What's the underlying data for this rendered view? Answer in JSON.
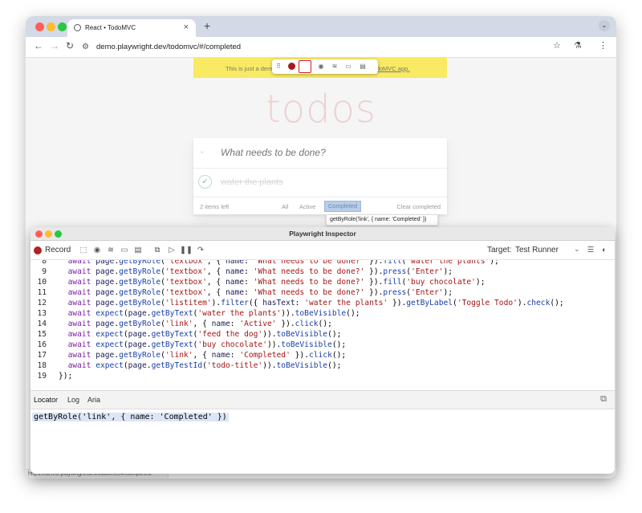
{
  "browser": {
    "tab_title": "React • TodoMVC",
    "new_tab_glyph": "+",
    "url": "demo.playwright.dev/todomvc/#/completed"
  },
  "page": {
    "banner_left": "This is just a dem",
    "banner_right": "al TodoMVC app.",
    "title": "todos",
    "new_todo_placeholder": "What needs to be done?",
    "todo_item": "water the plants",
    "items_left": "2 items left",
    "filters": [
      "All",
      "Active",
      "Completed"
    ],
    "clear_completed": "Clear completed",
    "tooltip": "getByRole('link', { name: 'Completed' })",
    "status_url": "https://demo.playwright.dev/todomvc/#/completed"
  },
  "inspector": {
    "title": "Playwright Inspector",
    "record_label": "Record",
    "target_label": "Target:",
    "target_value": "Test Runner",
    "tabs": [
      "Locator",
      "Log",
      "Aria"
    ],
    "locator": "getByRole('link', { name: 'Completed' })",
    "code_lines": [
      [
        {
          "t": "  "
        },
        {
          "c": "kw",
          "t": "await"
        },
        {
          "t": " "
        },
        {
          "c": "pr",
          "t": "page"
        },
        {
          "t": "."
        },
        {
          "c": "fn",
          "t": "getByRole"
        },
        {
          "t": "("
        },
        {
          "c": "st",
          "t": "'textbox'"
        },
        {
          "t": ", { "
        },
        {
          "c": "pr",
          "t": "name"
        },
        {
          "t": ": "
        },
        {
          "c": "st",
          "t": "'What needs to be done?'"
        },
        {
          "t": " })."
        },
        {
          "c": "fn",
          "t": "fill"
        },
        {
          "t": "("
        },
        {
          "c": "st",
          "t": "'water the plants'"
        },
        {
          "t": ");"
        }
      ],
      [
        {
          "t": "  "
        },
        {
          "c": "kw",
          "t": "await"
        },
        {
          "t": " "
        },
        {
          "c": "pr",
          "t": "page"
        },
        {
          "t": "."
        },
        {
          "c": "fn",
          "t": "getByRole"
        },
        {
          "t": "("
        },
        {
          "c": "st",
          "t": "'textbox'"
        },
        {
          "t": ", { "
        },
        {
          "c": "pr",
          "t": "name"
        },
        {
          "t": ": "
        },
        {
          "c": "st",
          "t": "'What needs to be done?'"
        },
        {
          "t": " })."
        },
        {
          "c": "fn",
          "t": "press"
        },
        {
          "t": "("
        },
        {
          "c": "st",
          "t": "'Enter'"
        },
        {
          "t": ");"
        }
      ],
      [
        {
          "t": "  "
        },
        {
          "c": "kw",
          "t": "await"
        },
        {
          "t": " "
        },
        {
          "c": "pr",
          "t": "page"
        },
        {
          "t": "."
        },
        {
          "c": "fn",
          "t": "getByRole"
        },
        {
          "t": "("
        },
        {
          "c": "st",
          "t": "'textbox'"
        },
        {
          "t": ", { "
        },
        {
          "c": "pr",
          "t": "name"
        },
        {
          "t": ": "
        },
        {
          "c": "st",
          "t": "'What needs to be done?'"
        },
        {
          "t": " })."
        },
        {
          "c": "fn",
          "t": "fill"
        },
        {
          "t": "("
        },
        {
          "c": "st",
          "t": "'buy chocolate'"
        },
        {
          "t": ");"
        }
      ],
      [
        {
          "t": "  "
        },
        {
          "c": "kw",
          "t": "await"
        },
        {
          "t": " "
        },
        {
          "c": "pr",
          "t": "page"
        },
        {
          "t": "."
        },
        {
          "c": "fn",
          "t": "getByRole"
        },
        {
          "t": "("
        },
        {
          "c": "st",
          "t": "'textbox'"
        },
        {
          "t": ", { "
        },
        {
          "c": "pr",
          "t": "name"
        },
        {
          "t": ": "
        },
        {
          "c": "st",
          "t": "'What needs to be done?'"
        },
        {
          "t": " })."
        },
        {
          "c": "fn",
          "t": "press"
        },
        {
          "t": "("
        },
        {
          "c": "st",
          "t": "'Enter'"
        },
        {
          "t": ");"
        }
      ],
      [
        {
          "t": "  "
        },
        {
          "c": "kw",
          "t": "await"
        },
        {
          "t": " "
        },
        {
          "c": "pr",
          "t": "page"
        },
        {
          "t": "."
        },
        {
          "c": "fn",
          "t": "getByRole"
        },
        {
          "t": "("
        },
        {
          "c": "st",
          "t": "'listitem'"
        },
        {
          "t": ")."
        },
        {
          "c": "fn",
          "t": "filter"
        },
        {
          "t": "({ "
        },
        {
          "c": "pr",
          "t": "hasText"
        },
        {
          "t": ": "
        },
        {
          "c": "st",
          "t": "'water the plants'"
        },
        {
          "t": " })."
        },
        {
          "c": "fn",
          "t": "getByLabel"
        },
        {
          "t": "("
        },
        {
          "c": "st",
          "t": "'Toggle Todo'"
        },
        {
          "t": ")."
        },
        {
          "c": "fn",
          "t": "check"
        },
        {
          "t": "();"
        }
      ],
      [
        {
          "t": "  "
        },
        {
          "c": "kw",
          "t": "await"
        },
        {
          "t": " "
        },
        {
          "c": "fn",
          "t": "expect"
        },
        {
          "t": "("
        },
        {
          "c": "pr",
          "t": "page"
        },
        {
          "t": "."
        },
        {
          "c": "fn",
          "t": "getByText"
        },
        {
          "t": "("
        },
        {
          "c": "st",
          "t": "'water the plants'"
        },
        {
          "t": "))."
        },
        {
          "c": "fn",
          "t": "toBeVisible"
        },
        {
          "t": "();"
        }
      ],
      [
        {
          "t": "  "
        },
        {
          "c": "kw",
          "t": "await"
        },
        {
          "t": " "
        },
        {
          "c": "pr",
          "t": "page"
        },
        {
          "t": "."
        },
        {
          "c": "fn",
          "t": "getByRole"
        },
        {
          "t": "("
        },
        {
          "c": "st",
          "t": "'link'"
        },
        {
          "t": ", { "
        },
        {
          "c": "pr",
          "t": "name"
        },
        {
          "t": ": "
        },
        {
          "c": "st",
          "t": "'Active'"
        },
        {
          "t": " })."
        },
        {
          "c": "fn",
          "t": "click"
        },
        {
          "t": "();"
        }
      ],
      [
        {
          "t": "  "
        },
        {
          "c": "kw",
          "t": "await"
        },
        {
          "t": " "
        },
        {
          "c": "fn",
          "t": "expect"
        },
        {
          "t": "("
        },
        {
          "c": "pr",
          "t": "page"
        },
        {
          "t": "."
        },
        {
          "c": "fn",
          "t": "getByText"
        },
        {
          "t": "("
        },
        {
          "c": "st",
          "t": "'feed the dog'"
        },
        {
          "t": "))."
        },
        {
          "c": "fn",
          "t": "toBeVisible"
        },
        {
          "t": "();"
        }
      ],
      [
        {
          "t": "  "
        },
        {
          "c": "kw",
          "t": "await"
        },
        {
          "t": " "
        },
        {
          "c": "fn",
          "t": "expect"
        },
        {
          "t": "("
        },
        {
          "c": "pr",
          "t": "page"
        },
        {
          "t": "."
        },
        {
          "c": "fn",
          "t": "getByText"
        },
        {
          "t": "("
        },
        {
          "c": "st",
          "t": "'buy chocolate'"
        },
        {
          "t": "))."
        },
        {
          "c": "fn",
          "t": "toBeVisible"
        },
        {
          "t": "();"
        }
      ],
      [
        {
          "t": "  "
        },
        {
          "c": "kw",
          "t": "await"
        },
        {
          "t": " "
        },
        {
          "c": "pr",
          "t": "page"
        },
        {
          "t": "."
        },
        {
          "c": "fn",
          "t": "getByRole"
        },
        {
          "t": "("
        },
        {
          "c": "st",
          "t": "'link'"
        },
        {
          "t": ", { "
        },
        {
          "c": "pr",
          "t": "name"
        },
        {
          "t": ": "
        },
        {
          "c": "st",
          "t": "'Completed'"
        },
        {
          "t": " })."
        },
        {
          "c": "fn",
          "t": "click"
        },
        {
          "t": "();"
        }
      ],
      [
        {
          "t": "  "
        },
        {
          "c": "kw",
          "t": "await"
        },
        {
          "t": " "
        },
        {
          "c": "fn",
          "t": "expect"
        },
        {
          "t": "("
        },
        {
          "c": "pr",
          "t": "page"
        },
        {
          "t": "."
        },
        {
          "c": "fn",
          "t": "getByTestId"
        },
        {
          "t": "("
        },
        {
          "c": "st",
          "t": "'todo-title'"
        },
        {
          "t": "))."
        },
        {
          "c": "fn",
          "t": "toBeVisible"
        },
        {
          "t": "();"
        }
      ],
      [
        {
          "t": "});"
        }
      ]
    ],
    "line_numbers": [
      "8",
      "9",
      "10",
      "11",
      "12",
      "13",
      "14",
      "15",
      "16",
      "17",
      "18",
      "19"
    ]
  },
  "icons": {
    "traffic_lights": [
      "#ff5f57",
      "#febc2e",
      "#28c840"
    ],
    "pw_toolbar": [
      "drag-handle-icon",
      "record-icon",
      "pick-locator-icon",
      "assert-visibility-icon",
      "assert-text-icon",
      "assert-value-icon",
      "assert-snapshot-icon"
    ],
    "inspector_toolbar": [
      "pick-locator-icon",
      "assert-visibility-icon",
      "assert-text-icon",
      "assert-value-icon",
      "assert-snapshot-icon",
      "copy-icon",
      "resume-icon",
      "pause-icon",
      "step-over-icon"
    ]
  },
  "colors": {
    "accent_record": "#b32020",
    "banner": "#f8ea62",
    "selected_filter": "#b8cde8"
  }
}
